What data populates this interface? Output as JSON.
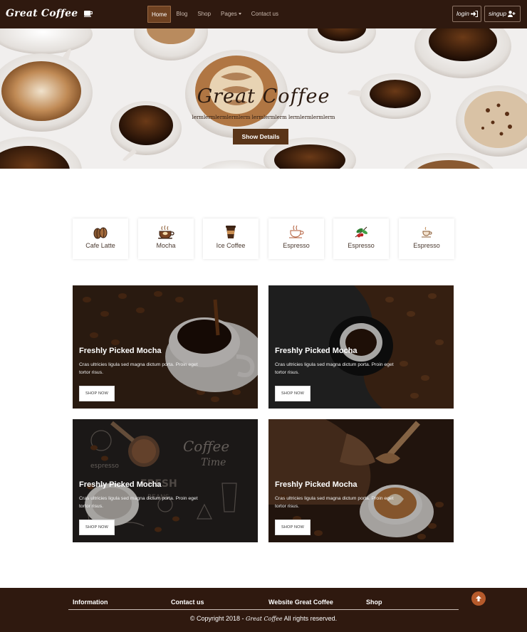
{
  "navbar": {
    "brand": "Great Coffee",
    "links": [
      {
        "label": "Home"
      },
      {
        "label": "Blog"
      },
      {
        "label": "Shop"
      },
      {
        "label": "Pages"
      },
      {
        "label": "Contact us"
      }
    ],
    "login_label": "login",
    "signup_label": "singup"
  },
  "hero": {
    "title": "Great Coffee",
    "subtitle": "lermlermlermlermlerm lermlermlerm lermlermlermlerm",
    "button_label": "Show Details"
  },
  "categories": [
    {
      "label": "Cafe Latte",
      "icon": "coffee-beans-icon"
    },
    {
      "label": "Mocha",
      "icon": "coffee-cup-icon"
    },
    {
      "label": "Ice Coffee",
      "icon": "takeaway-cup-icon"
    },
    {
      "label": "Espresso",
      "icon": "steaming-cup-icon"
    },
    {
      "label": "Espresso",
      "icon": "coffee-branch-icon"
    },
    {
      "label": "Espresso",
      "icon": "small-cup-icon"
    }
  ],
  "cards": [
    {
      "title": "Freshly Picked Mocha",
      "text": "Cras ultricies ligula sed magna dictum porta. Proin eget tortor risus.",
      "button_label": "SHOP NOW"
    },
    {
      "title": "Freshly Picked Mocha",
      "text": "Cras ultricies ligula sed magna dictum porta. Proin eget tortor risus.",
      "button_label": "SHOP NOW"
    },
    {
      "title": "Freshly Picked Mocha",
      "text": "Cras ultricies ligula sed magna dictum porta. Proin eget tortor risus.",
      "button_label": "SHOP NOW"
    },
    {
      "title": "Freshly Picked Mocha",
      "text": "Cras ultricies ligula sed magna dictum porta. Proin eget tortor risus.",
      "button_label": "SHOP NOW"
    }
  ],
  "footer": {
    "columns": [
      "Information",
      "Contact us",
      "Website Great Coffee",
      "Shop"
    ],
    "copyright_prefix": "© Copyright 2018 -",
    "copyright_brand": "Great Coffee",
    "copyright_suffix": "All rights reserved."
  },
  "colors": {
    "nav_background": "#2f190f",
    "accent_brown": "#5a3519",
    "scroll_top_button": "#b65a2b"
  }
}
